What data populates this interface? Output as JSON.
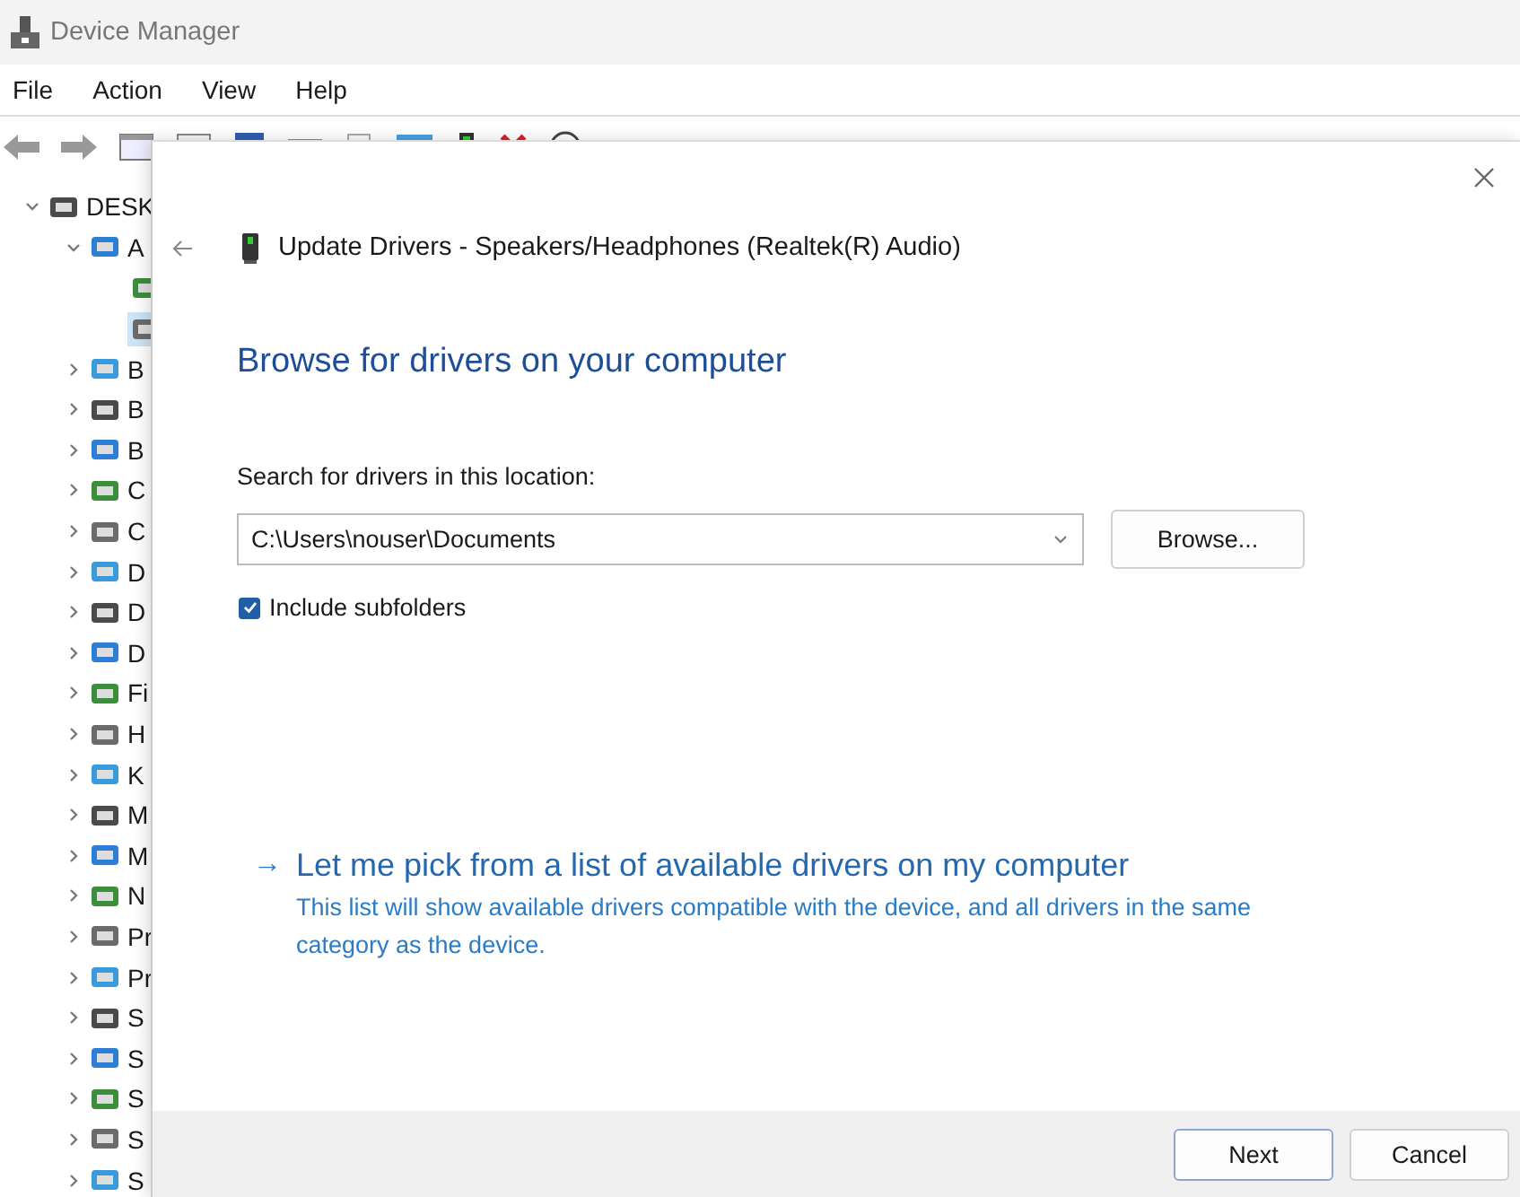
{
  "window": {
    "title": "Device Manager"
  },
  "menu": [
    "File",
    "Action",
    "View",
    "Help"
  ],
  "tree": [
    {
      "label": "DESK",
      "expanded": true,
      "selected": false,
      "children": [
        {
          "label": "A",
          "expanded": true,
          "selected": false,
          "children": [
            {
              "selected": false
            },
            {
              "selected": true
            }
          ]
        },
        {
          "label": "B",
          "expanded": false,
          "selected": false
        },
        {
          "label": "B",
          "expanded": false,
          "selected": false
        },
        {
          "label": "B",
          "expanded": false,
          "selected": false
        },
        {
          "label": "C",
          "expanded": false,
          "selected": false
        },
        {
          "label": "C",
          "expanded": false,
          "selected": false
        },
        {
          "label": "D",
          "expanded": false,
          "selected": false
        },
        {
          "label": "D",
          "expanded": false,
          "selected": false
        },
        {
          "label": "D",
          "expanded": false,
          "selected": false
        },
        {
          "label": "Fi",
          "expanded": false,
          "selected": false
        },
        {
          "label": "H",
          "expanded": false,
          "selected": false
        },
        {
          "label": "K",
          "expanded": false,
          "selected": false
        },
        {
          "label": "M",
          "expanded": false,
          "selected": false
        },
        {
          "label": "M",
          "expanded": false,
          "selected": false
        },
        {
          "label": "N",
          "expanded": false,
          "selected": false
        },
        {
          "label": "Pr",
          "expanded": false,
          "selected": false
        },
        {
          "label": "Pr",
          "expanded": false,
          "selected": false
        },
        {
          "label": "S",
          "expanded": false,
          "selected": false
        },
        {
          "label": "S",
          "expanded": false,
          "selected": false
        },
        {
          "label": "S",
          "expanded": false,
          "selected": false
        },
        {
          "label": "S",
          "expanded": false,
          "selected": false
        },
        {
          "label": "S",
          "expanded": false,
          "selected": false
        }
      ]
    }
  ],
  "dialog": {
    "title": "Update Drivers - Speakers/Headphones (Realtek(R) Audio)",
    "heading": "Browse for drivers on your computer",
    "location_label": "Search for drivers in this location:",
    "location_value": "C:\\Users\\nouser\\Documents",
    "browse_button": "Browse...",
    "include_subfolders": {
      "label": "Include subfolders",
      "checked": true
    },
    "link": {
      "arrow": "→",
      "label": "Let me pick from a list of available drivers on my computer",
      "description": "This list will show available drivers compatible with the device, and all drivers in the same category as the device."
    },
    "buttons": [
      "Next",
      "Cancel"
    ]
  }
}
